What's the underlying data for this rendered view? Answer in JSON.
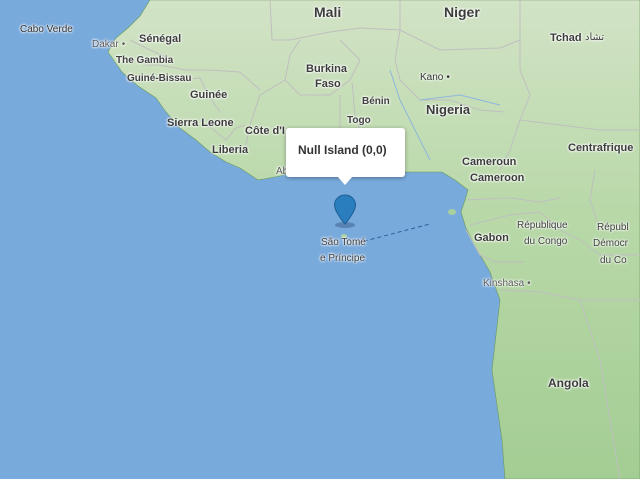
{
  "map": {
    "colors": {
      "ocean": "#79aadc",
      "land_light": "#c6dfbd",
      "land_green": "#a9d09c",
      "border": "#b8b8b8",
      "marker": "#2a7ebd",
      "popup_bg": "#ffffff"
    },
    "labels": {
      "mali": "Mali",
      "niger": "Niger",
      "tchad": "Tchad",
      "tchad_arabic": "تشاد",
      "cabo_verde": "Cabo Verde",
      "dakar": "Dakar",
      "senegal": "Sénégal",
      "gambia": "The Gambia",
      "guinea_bissau": "Guiné-Bissau",
      "guinee": "Guinée",
      "sierra_leone": "Sierra Leone",
      "liberia": "Liberia",
      "cote_divoire": "Côte d'I",
      "abidjan": "Ab",
      "burkina": "Burkina",
      "faso": "Faso",
      "benin": "Bénin",
      "togo": "Togo",
      "kano": "Kano",
      "nigeria": "Nigeria",
      "cameroun": "Cameroun",
      "cameroon": "Cameroon",
      "centrafrique": "Centrafrique",
      "sao_tome_1": "São Tomé",
      "sao_tome_2": "e Príncipe",
      "gabon": "Gabon",
      "rep_congo_1": "République",
      "rep_congo_2": "du Congo",
      "rdc_1": "Républ",
      "rdc_2": "Démocr",
      "rdc_3": "du Co",
      "kinshasa": "Kinshasa",
      "angola": "Angola"
    },
    "popup": {
      "text": "Null Island (0,0)"
    },
    "marker_icon": "map-pin-icon"
  }
}
